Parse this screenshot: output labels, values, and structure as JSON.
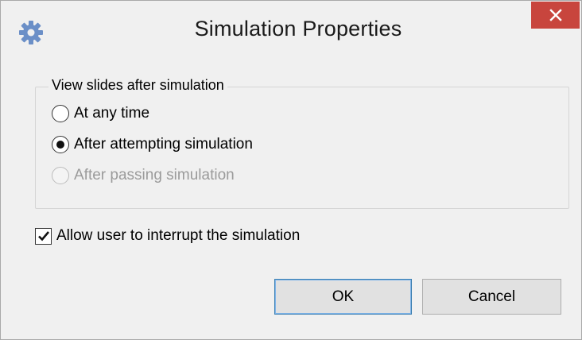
{
  "window": {
    "title": "Simulation Properties",
    "icon": "gear-icon",
    "close_icon": "close-icon",
    "close_color": "#c8453d"
  },
  "group": {
    "legend": "View slides after simulation",
    "options": [
      {
        "label": "At any time",
        "checked": false,
        "disabled": false
      },
      {
        "label": "After attempting simulation",
        "checked": true,
        "disabled": false
      },
      {
        "label": "After passing simulation",
        "checked": false,
        "disabled": true
      }
    ]
  },
  "interrupt": {
    "label": "Allow user to interrupt the simulation",
    "checked": true
  },
  "buttons": {
    "ok_label": "OK",
    "cancel_label": "Cancel"
  }
}
